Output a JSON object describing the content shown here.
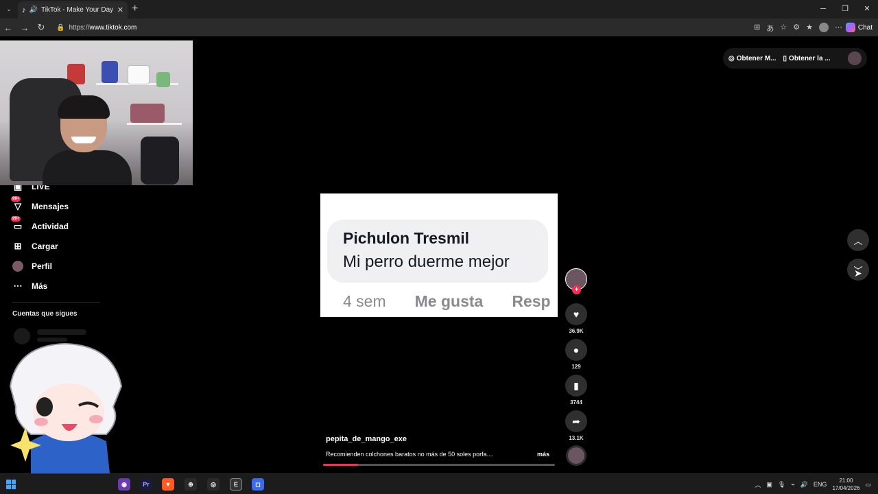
{
  "browser": {
    "tab_title": "TikTok - Make Your Day",
    "url_scheme": "https://",
    "url_host": "www.tiktok.com",
    "chat_label": "Chat"
  },
  "sidebar": {
    "items": [
      {
        "label": "LIVE",
        "icon": "live-icon"
      },
      {
        "label": "Mensajes",
        "icon": "messages-icon",
        "badge": "99+"
      },
      {
        "label": "Actividad",
        "icon": "activity-icon",
        "badge": "99+"
      },
      {
        "label": "Cargar",
        "icon": "upload-icon"
      },
      {
        "label": "Perfil",
        "icon": "avatar"
      },
      {
        "label": "Más",
        "icon": "more-icon"
      }
    ],
    "following_heading": "Cuentas que sigues"
  },
  "topbar": {
    "coins_label": "Obtener M...",
    "app_label": "Obtener la ..."
  },
  "video": {
    "comment_author": "Pichulon Tresmil",
    "comment_text": "Mi perro duerme mejor",
    "comment_age": "4 sem",
    "comment_like": "Me gusta",
    "comment_reply": "Resp"
  },
  "actions": {
    "likes": "36.9K",
    "comments": "129",
    "saves": "3744",
    "shares": "13.1K"
  },
  "caption": {
    "author": "pepita_de_mango_exe",
    "description": "Recomienden colchones baratos no más de 50 soles porfa....",
    "more": "más",
    "progress": 0.15
  },
  "taskbar": {
    "language": "ENG",
    "time": "21:00",
    "date": "17/04/2026"
  },
  "colors": {
    "accent": "#fe2c55",
    "background": "#000000"
  }
}
